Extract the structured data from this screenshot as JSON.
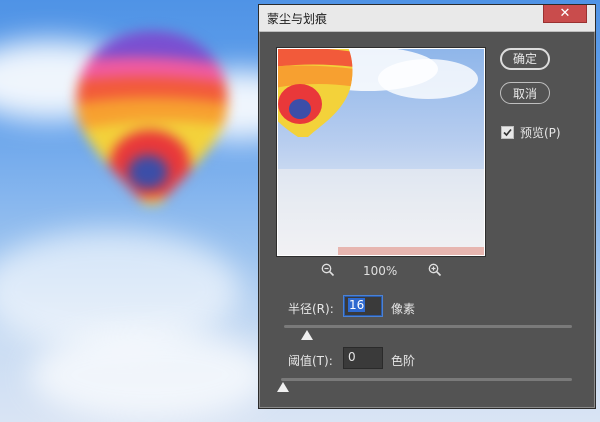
{
  "dialog": {
    "title": "蒙尘与划痕",
    "close_icon": "close-icon"
  },
  "buttons": {
    "ok": "确定",
    "cancel": "取消"
  },
  "preview_checkbox": {
    "label": "预览(P)",
    "checked": true
  },
  "zoom": {
    "value": "100%",
    "zoom_out_icon": "zoom-out-icon",
    "zoom_in_icon": "zoom-in-icon"
  },
  "radius": {
    "label": "半径(R):",
    "value": "16",
    "unit": "像素",
    "slider_fraction": 0.08
  },
  "threshold": {
    "label": "阈值(T):",
    "value": "0",
    "unit": "色阶",
    "slider_fraction": 0.0
  },
  "colors": {
    "dialog_bg": "#535353",
    "titlebar_bg": "#e9e9e9",
    "close_bg": "#c94c4c",
    "accent_selection": "#2f6ad0"
  }
}
